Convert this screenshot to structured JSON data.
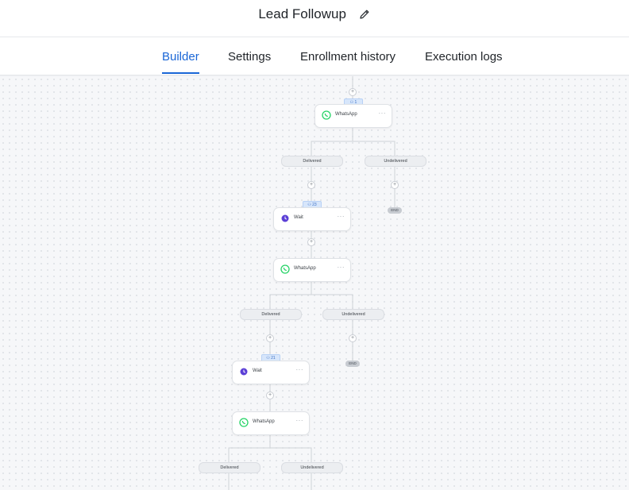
{
  "header": {
    "title": "Lead Followup",
    "edit_icon": "pencil-icon"
  },
  "tabs": [
    {
      "label": "Builder",
      "active": true
    },
    {
      "label": "Settings",
      "active": false
    },
    {
      "label": "Enrollment history",
      "active": false
    },
    {
      "label": "Execution logs",
      "active": false
    }
  ],
  "colors": {
    "accent": "#1a66d6",
    "whatsapp": "#25d366",
    "wait": "#5b3fd6"
  },
  "flow": {
    "plus_glyph": "+",
    "node_menu": "···",
    "badges": [
      "⚇ 1",
      "⚇ 23",
      "⚇ 21"
    ],
    "nodes": [
      {
        "type": "whatsapp",
        "label": "WhatsApp",
        "icon": "whatsapp-icon"
      },
      {
        "type": "wait",
        "label": "Wait",
        "icon": "clock-icon"
      },
      {
        "type": "whatsapp",
        "label": "WhatsApp",
        "icon": "whatsapp-icon"
      },
      {
        "type": "wait",
        "label": "Wait",
        "icon": "clock-icon"
      },
      {
        "type": "whatsapp",
        "label": "WhatsApp",
        "icon": "whatsapp-icon"
      }
    ],
    "branches": [
      {
        "left": "Delivered",
        "right": "Undelivered",
        "right_end": "END"
      },
      {
        "left": "Delivered",
        "right": "Undelivered",
        "right_end": "END"
      },
      {
        "left": "Delivered",
        "right": "Undelivered"
      }
    ]
  }
}
